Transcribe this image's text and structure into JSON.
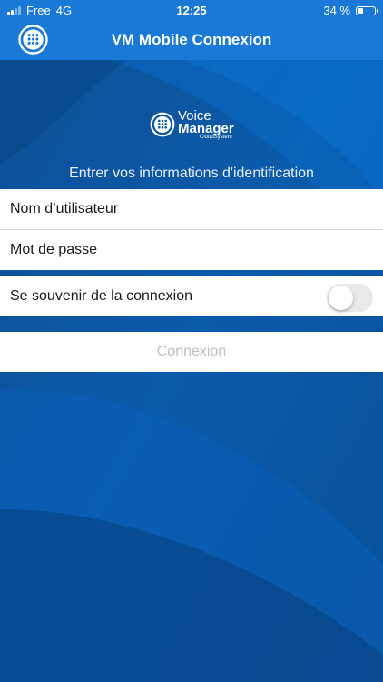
{
  "status": {
    "carrier": "Free",
    "network": "4G",
    "time": "12:25",
    "battery": "34 %",
    "battery_level": 0.34
  },
  "nav": {
    "title": "VM Mobile Connexion",
    "icon": "voice-manager-app-icon"
  },
  "logo": {
    "line1": "Voice",
    "line2": "Manager",
    "line3": "CloudSystem"
  },
  "login": {
    "instruction": "Entrer vos informations d'identification",
    "username_placeholder": "Nom d’utilisateur",
    "password_placeholder": "Mot de passe",
    "remember_label": "Se souvenir de la connexion",
    "remember_on": false,
    "submit_label": "Connexion"
  },
  "colors": {
    "bar": "#1a78d6",
    "background": "#0b5aa5",
    "button_disabled_text": "#c0c0c3"
  }
}
